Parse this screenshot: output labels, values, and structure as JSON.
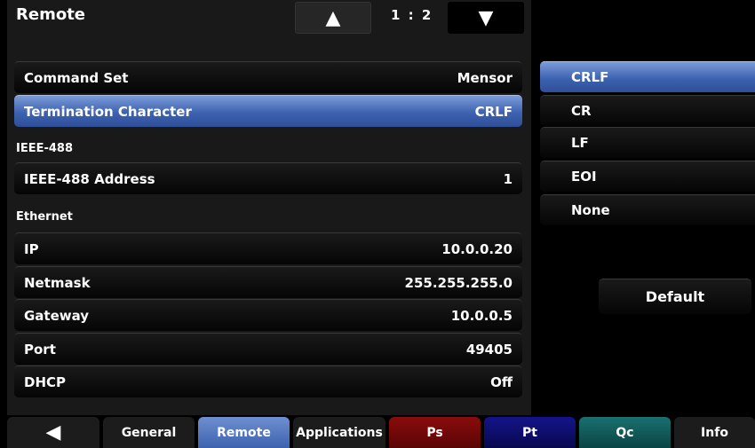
{
  "header": {
    "title": "Remote",
    "page_indicator": "1 : 2",
    "up_icon": "▲",
    "down_icon": "▼"
  },
  "settings": {
    "command_set": {
      "label": "Command Set",
      "value": "Mensor"
    },
    "termination": {
      "label": "Termination Character",
      "value": "CRLF"
    },
    "ieee_section": "IEEE-488",
    "ieee_address": {
      "label": "IEEE-488 Address",
      "value": "1"
    },
    "ethernet_section": "Ethernet",
    "ip": {
      "label": "IP",
      "value": "10.0.0.20"
    },
    "netmask": {
      "label": "Netmask",
      "value": "255.255.255.0"
    },
    "gateway": {
      "label": "Gateway",
      "value": "10.0.0.5"
    },
    "port": {
      "label": "Port",
      "value": "49405"
    },
    "dhcp": {
      "label": "DHCP",
      "value": "Off"
    }
  },
  "termination_options": [
    "CRLF",
    "CR",
    "LF",
    "EOI",
    "None"
  ],
  "termination_selected": "CRLF",
  "default_button": "Default",
  "tabs": {
    "back_icon": "◀",
    "general": "General",
    "remote": "Remote",
    "applications": "Applications",
    "ps": "Ps",
    "pt": "Pt",
    "qc": "Qc",
    "info": "Info"
  },
  "colors": {
    "selected": "#3d62b0",
    "remote_tab": "#4a6fc0",
    "ps_tab": "#7a0a0a",
    "pt_tab": "#0a0a66",
    "qc_tab": "#0d5a5a"
  }
}
